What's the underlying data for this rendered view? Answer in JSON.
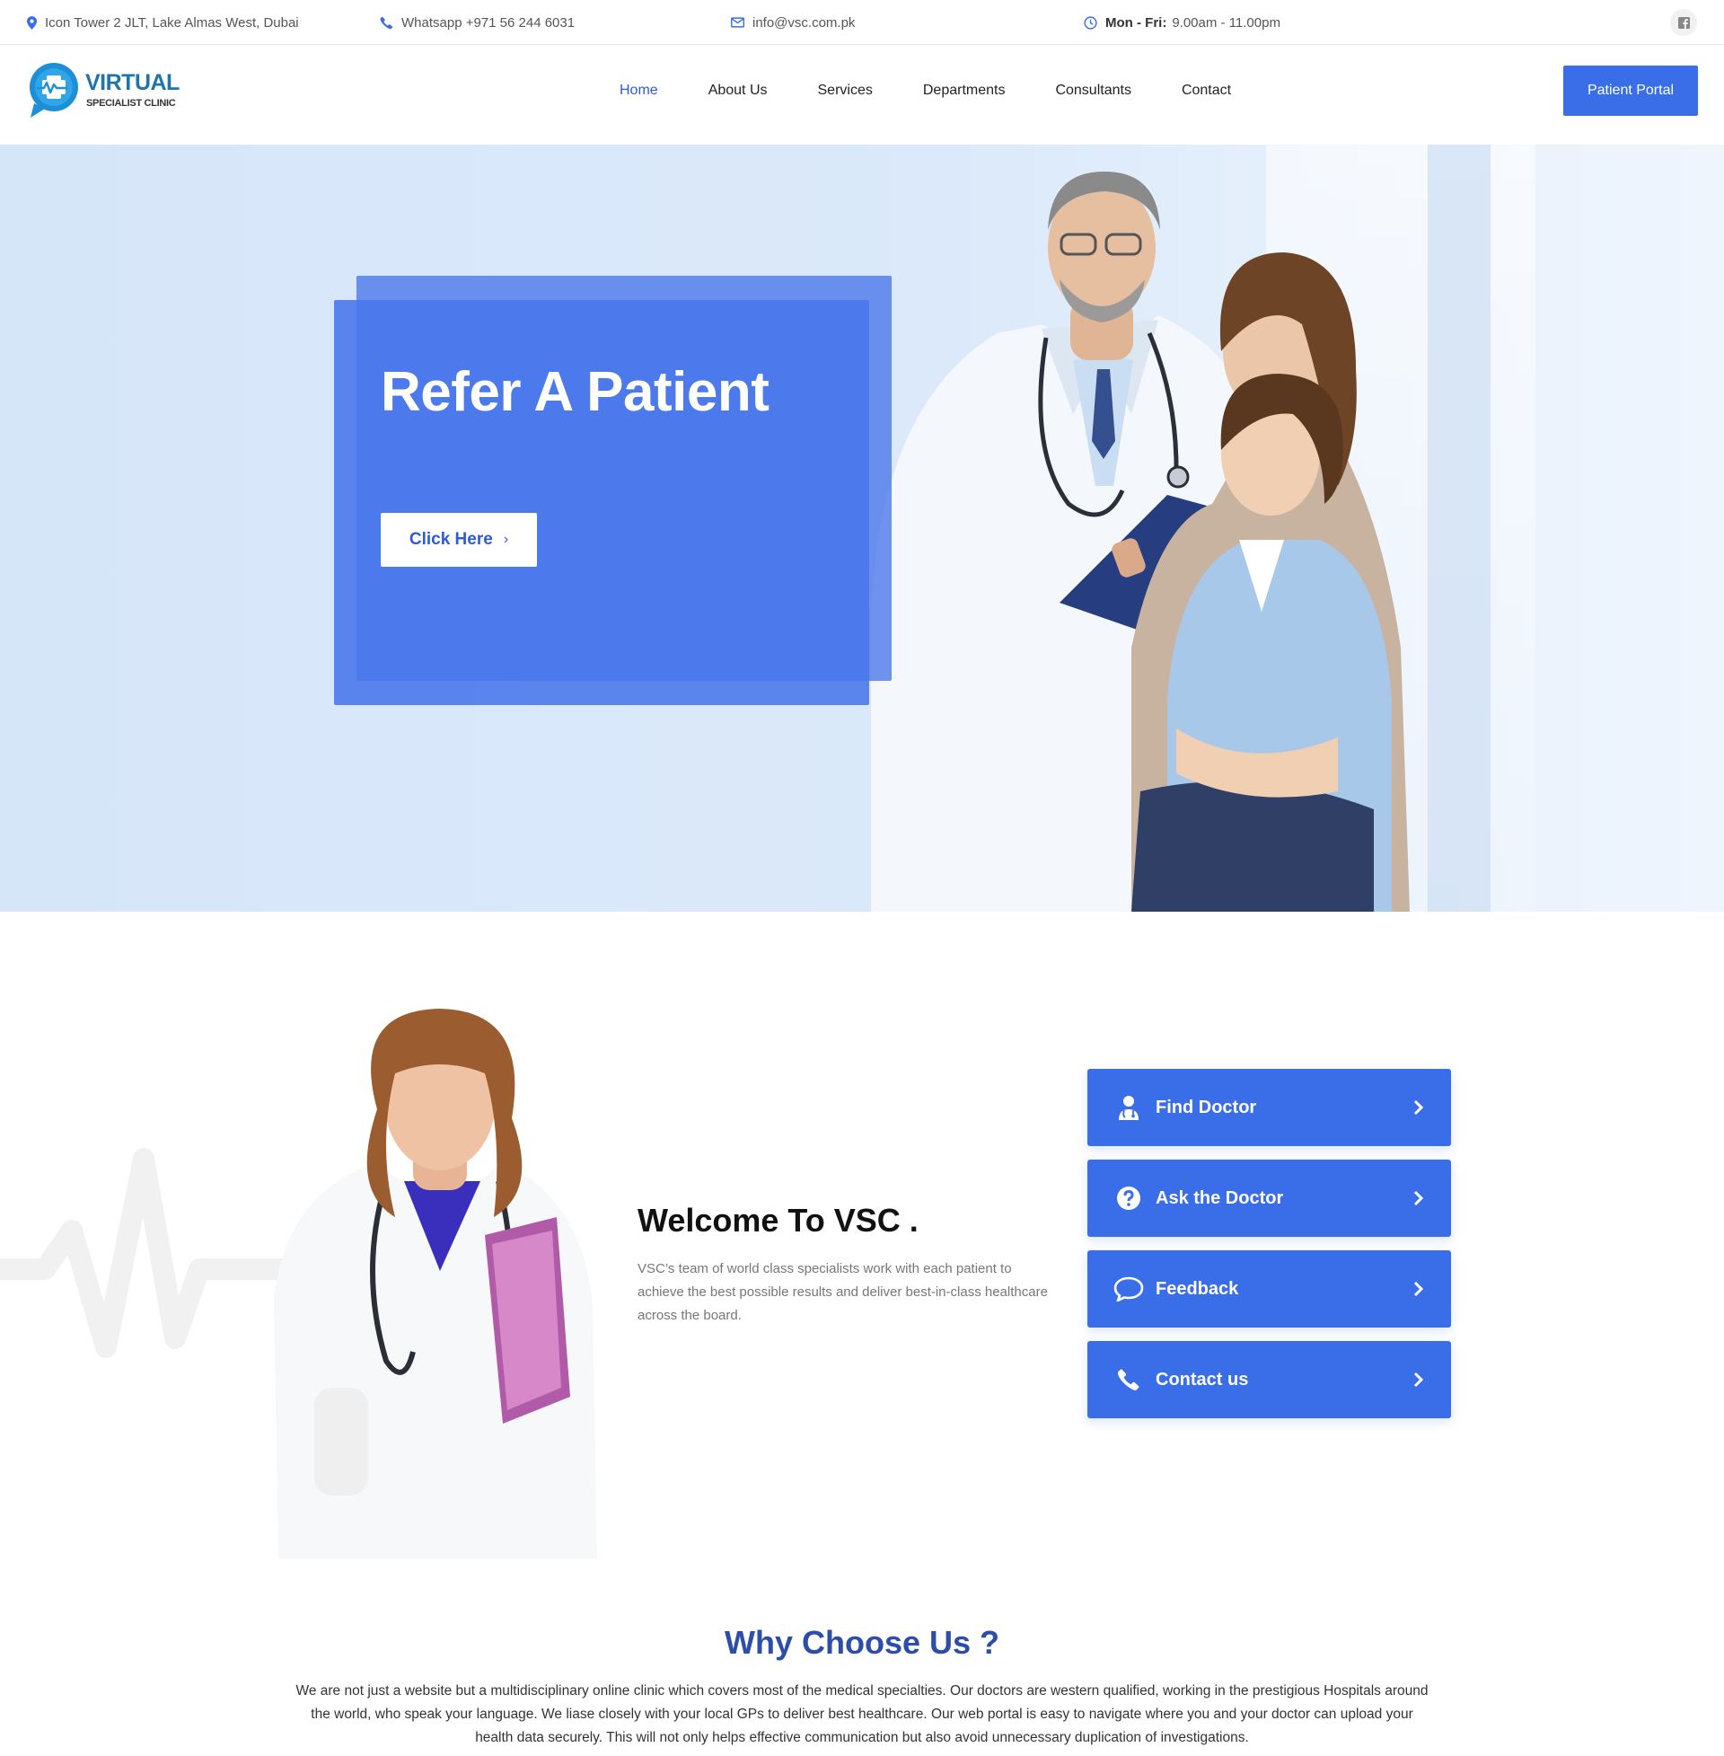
{
  "topbar": {
    "address": "Icon Tower 2 JLT, Lake Almas West, Dubai",
    "phone": "Whatsapp +971 56 244 6031",
    "email": "info@vsc.com.pk",
    "hours_label": "Mon - Fri:",
    "hours_value": "9.00am - 11.00pm",
    "social_icon": "facebook-icon"
  },
  "header": {
    "logo_title": "VIRTUAL",
    "logo_subtitle": "SPECIALIST CLINIC",
    "nav": [
      "Home",
      "About Us",
      "Services",
      "Departments",
      "Consultants",
      "Contact"
    ],
    "active_nav": "Home",
    "portal_button": "Patient Portal"
  },
  "hero": {
    "title": "Refer A Patient",
    "button_label": "Click Here",
    "button_icon": "chevron-right-icon"
  },
  "welcome": {
    "title": "Welcome To VSC .",
    "text": "VSC’s team of world class specialists work with each patient to achieve the best possible results and deliver best-in-class healthcare across the board.",
    "actions": [
      {
        "label": "Find Doctor",
        "icon": "doctor-icon"
      },
      {
        "label": "Ask the Doctor",
        "icon": "question-icon"
      },
      {
        "label": "Feedback",
        "icon": "chat-bubble-icon"
      },
      {
        "label": "Contact us",
        "icon": "phone-icon"
      }
    ]
  },
  "why": {
    "title": "Why Choose Us ?",
    "text": "We are not just a website but a multidisciplinary online clinic which covers most of the medical specialties. Our doctors are western qualified, working in the prestigious Hospitals around the world, who speak your language. We liase closely with your local GPs to deliver best healthcare. Our web portal is easy to navigate where you and your doctor can upload your health data securely. This will not only helps effective communication but also avoid unnecessary duplication of investigations."
  },
  "colors": {
    "primary": "#3a6ee8",
    "nav_active": "#2f5bd7",
    "heading_blue": "#2c4da8",
    "logo_blue": "#1f74ad",
    "hero_bg": "#d6e6f9"
  }
}
